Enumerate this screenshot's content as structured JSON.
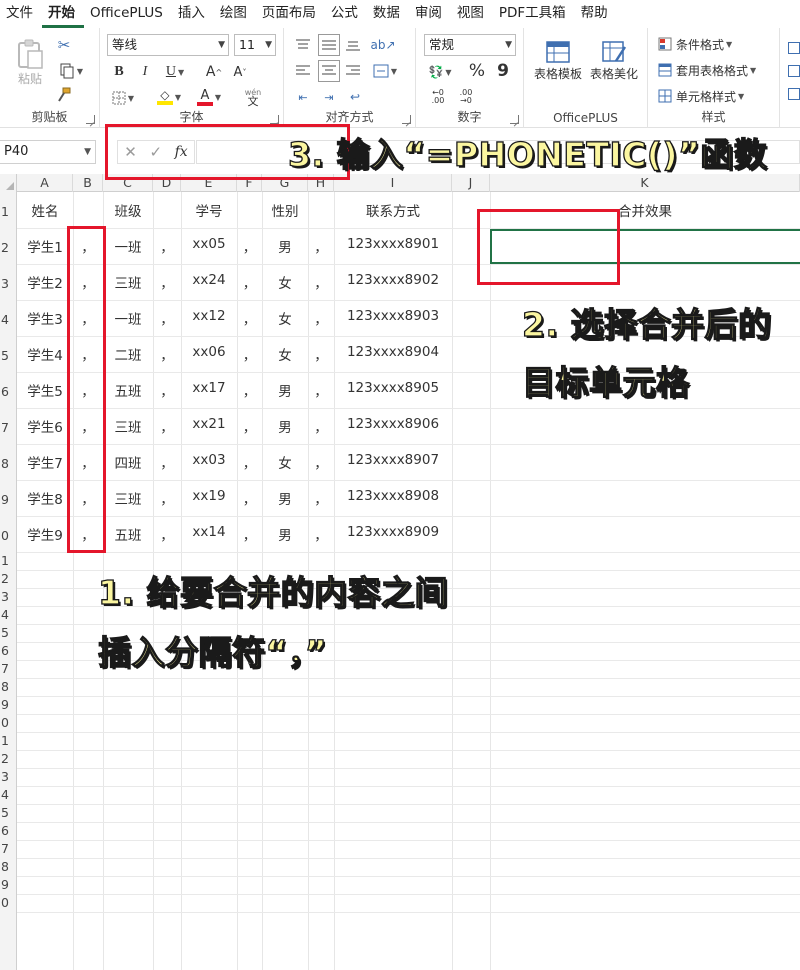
{
  "menu": {
    "items": [
      "文件",
      "开始",
      "OfficePLUS",
      "插入",
      "绘图",
      "页面布局",
      "公式",
      "数据",
      "审阅",
      "视图",
      "PDF工具箱",
      "帮助"
    ],
    "active": "开始"
  },
  "ribbon": {
    "clipboard": {
      "paste_label": "粘贴",
      "group_label": "剪贴板"
    },
    "font": {
      "font_name": "等线",
      "font_size": "11",
      "bold": "B",
      "italic": "I",
      "underline": "U",
      "grow": "A",
      "shrink": "A",
      "wen": "wén",
      "wen_char": "文",
      "group_label": "字体",
      "highlight_color": "#ffe600",
      "font_color": "#e4162b"
    },
    "align": {
      "group_label": "对齐方式"
    },
    "number": {
      "format": "常规",
      "percent": "%",
      "comma": "9",
      "group_label": "数字"
    },
    "officeplus": {
      "table_template": "表格模板",
      "table_beautify": "表格美化",
      "group_label": "OfficePLUS"
    },
    "styles": {
      "conditional": "条件格式",
      "table_format": "套用表格格式",
      "cell_style": "单元格样式",
      "group_label": "样式"
    }
  },
  "formula_bar": {
    "name_box": "P40",
    "cancel": "✕",
    "enter": "✓",
    "fx": "fx",
    "value": ""
  },
  "columns": [
    "A",
    "B",
    "C",
    "D",
    "E",
    "F",
    "G",
    "H",
    "I",
    "J",
    "K"
  ],
  "row_numbers": [
    "1",
    "2",
    "3",
    "4",
    "5",
    "6",
    "7",
    "8",
    "9",
    "0",
    "1",
    "2",
    "3",
    "4",
    "5",
    "6",
    "7",
    "8",
    "9",
    "0",
    "1",
    "2",
    "3",
    "4",
    "5",
    "6",
    "7",
    "8",
    "9",
    "0"
  ],
  "headers": {
    "name": "姓名",
    "class": "班级",
    "id": "学号",
    "gender": "性别",
    "contact": "联系方式",
    "merge": "合并效果"
  },
  "separator": "，",
  "rows": [
    {
      "name": "学生1",
      "class": "一班",
      "id": "xx05",
      "gender": "男",
      "contact": "123xxxx8901"
    },
    {
      "name": "学生2",
      "class": "三班",
      "id": "xx24",
      "gender": "女",
      "contact": "123xxxx8902"
    },
    {
      "name": "学生3",
      "class": "一班",
      "id": "xx12",
      "gender": "女",
      "contact": "123xxxx8903"
    },
    {
      "name": "学生4",
      "class": "二班",
      "id": "xx06",
      "gender": "女",
      "contact": "123xxxx8904"
    },
    {
      "name": "学生5",
      "class": "五班",
      "id": "xx17",
      "gender": "男",
      "contact": "123xxxx8905"
    },
    {
      "name": "学生6",
      "class": "三班",
      "id": "xx21",
      "gender": "男",
      "contact": "123xxxx8906"
    },
    {
      "name": "学生7",
      "class": "四班",
      "id": "xx03",
      "gender": "女",
      "contact": "123xxxx8907"
    },
    {
      "name": "学生8",
      "class": "三班",
      "id": "xx19",
      "gender": "男",
      "contact": "123xxxx8908"
    },
    {
      "name": "学生9",
      "class": "五班",
      "id": "xx14",
      "gender": "男",
      "contact": "123xxxx8909"
    }
  ],
  "annotations": {
    "step1_line1": "1. 给要合并的内容之间",
    "step1_line2": "插入分隔符“，”",
    "step2_line1": "2. 选择合并后的",
    "step2_line2": "目标单元格",
    "step3": "3. 输入“=PHONETIC()”函数"
  },
  "colors": {
    "accent": "#1f7145",
    "annotation_red": "#e4162b",
    "callout_fill": "#fbf6a0",
    "selection_border": "#217346"
  }
}
